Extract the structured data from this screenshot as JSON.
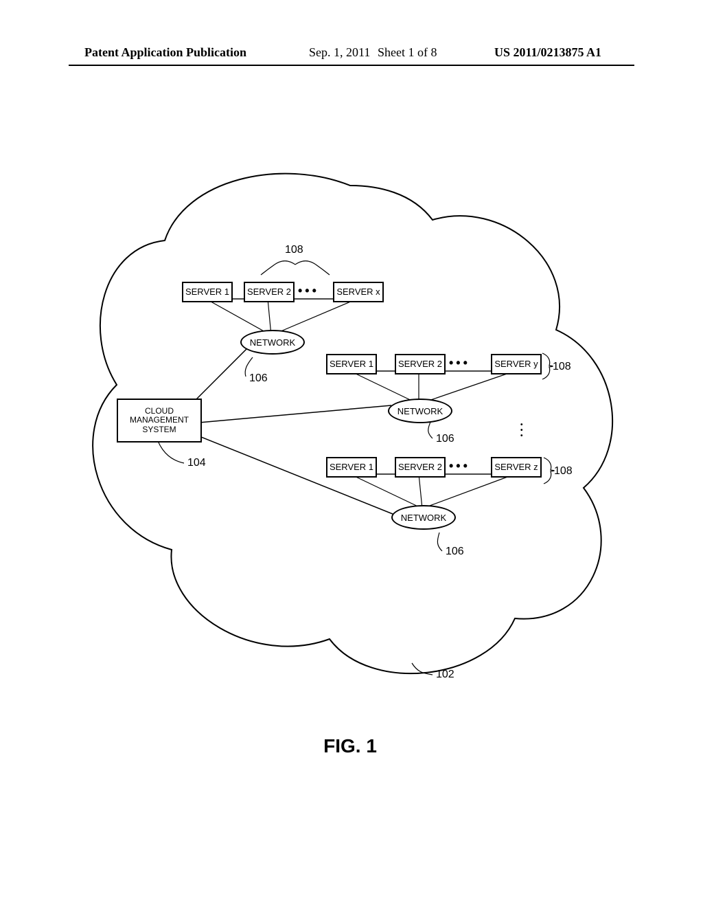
{
  "header": {
    "left": "Patent Application Publication",
    "date": "Sep. 1, 2011",
    "sheet": "Sheet 1 of 8",
    "pubno": "US 2011/0213875 A1"
  },
  "labels": {
    "server1": "SERVER 1",
    "server2": "SERVER 2",
    "serverX": "SERVER x",
    "serverY": "SERVER y",
    "serverZ": "SERVER z",
    "network": "NETWORK",
    "cms_l1": "CLOUD",
    "cms_l2": "MANAGEMENT",
    "cms_l3": "SYSTEM"
  },
  "refs": {
    "r102": "102",
    "r104": "104",
    "r106": "106",
    "r108": "108"
  },
  "figure": {
    "caption": "FIG. 1"
  }
}
